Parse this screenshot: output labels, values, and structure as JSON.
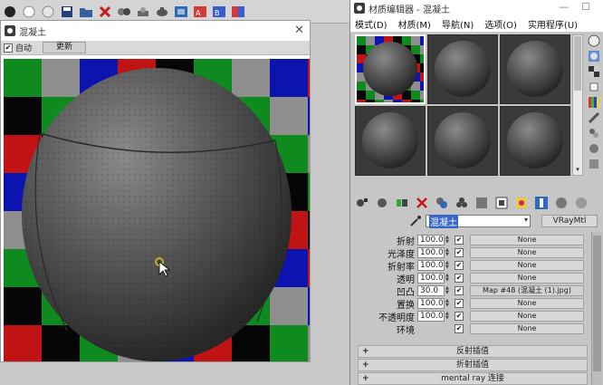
{
  "render_window": {
    "title": "混凝土",
    "close": "✕",
    "auto_checked": "✔",
    "auto_label": "自动",
    "update_button": "更新"
  },
  "material_editor": {
    "title": "材质编辑器 - 混凝土",
    "window_controls": {
      "minimize": "—",
      "maximize": "☐"
    },
    "menu": [
      "模式(D)",
      "材质(M)",
      "导航(N)",
      "选项(O)",
      "实用程序(U)"
    ],
    "material_name": "混凝土",
    "material_type": "VRayMtl",
    "maps": [
      {
        "label": "折射",
        "value": "100.0",
        "checked": "✔",
        "map": "None"
      },
      {
        "label": "光泽度",
        "value": "100.0",
        "checked": "✔",
        "map": "None"
      },
      {
        "label": "折射率",
        "value": "100.0",
        "checked": "✔",
        "map": "None"
      },
      {
        "label": "透明",
        "value": "100.0",
        "checked": "✔",
        "map": "None"
      },
      {
        "label": "凹凸",
        "value": "30.0",
        "checked": "✔",
        "map": "Map #48 (混凝土 (1).jpg)"
      },
      {
        "label": "置换",
        "value": "100.0",
        "checked": "✔",
        "map": "None"
      },
      {
        "label": "不透明度",
        "value": "100.0",
        "checked": "✔",
        "map": "None"
      },
      {
        "label": "环境",
        "value": "",
        "checked": "✔",
        "map": "None"
      }
    ],
    "rollouts": [
      {
        "plus": "+",
        "label": "反射插值"
      },
      {
        "plus": "+",
        "label": "折射插值"
      },
      {
        "plus": "+",
        "label": "mental ray 连接"
      }
    ]
  },
  "colors": {
    "checker_red": "#c01414",
    "checker_green": "#0e8a1e",
    "checker_blue": "#0c14b0",
    "checker_gray": "#8e8e8e",
    "checker_black": "#060606",
    "sphere": "#5a5a5a",
    "selection": "#3867c8"
  }
}
